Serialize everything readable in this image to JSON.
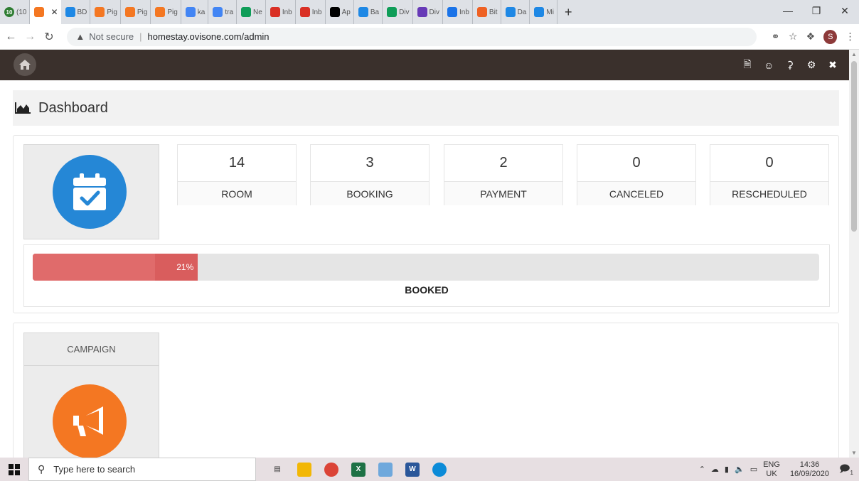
{
  "browser": {
    "tabs": [
      {
        "label": "(10",
        "icon": "notification-count-icon",
        "color": "#2e7d32",
        "badge": "10"
      },
      {
        "label": "",
        "icon": "pigeon-icon",
        "color": "#f47722",
        "active": true
      },
      {
        "label": "BD",
        "icon": "google-drive-icon",
        "color": "#1e88e5"
      },
      {
        "label": "Pig",
        "icon": "pig-icon",
        "color": "#f47722"
      },
      {
        "label": "Pig",
        "icon": "pig-icon",
        "color": "#f47722"
      },
      {
        "label": "Pig",
        "icon": "pigeon-icon",
        "color": "#f47722"
      },
      {
        "label": "ka",
        "icon": "google-icon",
        "color": "#4285f4"
      },
      {
        "label": "tra",
        "icon": "google-icon",
        "color": "#4285f4"
      },
      {
        "label": "Ne",
        "icon": "sheets-icon",
        "color": "#0f9d58"
      },
      {
        "label": "Inb",
        "icon": "gmail-icon",
        "color": "#d93025"
      },
      {
        "label": "Inb",
        "icon": "gmail-icon",
        "color": "#d93025"
      },
      {
        "label": "Ap",
        "icon": "medium-icon",
        "color": "#000000"
      },
      {
        "label": "Ba",
        "icon": "google-drive-icon",
        "color": "#1e88e5"
      },
      {
        "label": "Div",
        "icon": "sheets-icon",
        "color": "#0f9d58"
      },
      {
        "label": "Div",
        "icon": "forms-icon",
        "color": "#673ab7"
      },
      {
        "label": "Inb",
        "icon": "mail-icon",
        "color": "#1a73e8"
      },
      {
        "label": "Bit",
        "icon": "bitly-icon",
        "color": "#ee6123"
      },
      {
        "label": "Da",
        "icon": "dashboard-icon",
        "color": "#1e88e5"
      },
      {
        "label": "Mi",
        "icon": "dashboard-icon",
        "color": "#1e88e5"
      }
    ],
    "address": {
      "security": "Not secure",
      "url": "homestay.ovisone.com/admin"
    },
    "profile_initial": "S"
  },
  "page": {
    "title": "Dashboard",
    "stats": [
      {
        "value": "14",
        "label": "ROOM"
      },
      {
        "value": "3",
        "label": "BOOKING"
      },
      {
        "value": "2",
        "label": "PAYMENT"
      },
      {
        "value": "0",
        "label": "CANCELED"
      },
      {
        "value": "0",
        "label": "RESCHEDULED"
      }
    ],
    "progress": {
      "percent": 21,
      "percent_text": "21%",
      "label": "BOOKED"
    },
    "campaign_label": "CAMPAIGN"
  },
  "colors": {
    "header_bg": "#3a302c",
    "calendar_circle": "#2587d6",
    "campaign_circle": "#f47722",
    "progress_fill": "#d95d5d"
  },
  "taskbar": {
    "search_placeholder": "Type here to search",
    "lang": "ENG",
    "region": "UK",
    "time": "14:36",
    "date": "16/09/2020",
    "notification_count": "1"
  }
}
